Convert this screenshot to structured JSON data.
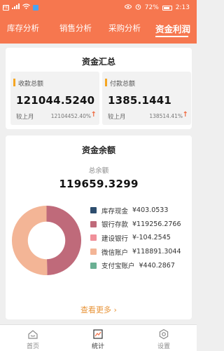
{
  "statusbar": {
    "left_badge": "HD",
    "battery": "72%",
    "time": "2:13"
  },
  "tabs": [
    {
      "label": "库存分析"
    },
    {
      "label": "销售分析"
    },
    {
      "label": "采购分析"
    },
    {
      "label": "资金利润"
    }
  ],
  "summary": {
    "title": "资金汇总",
    "receipts": {
      "label": "收款总额",
      "value": "121044.5240",
      "compare_label": "较上月",
      "percent": "12104452.40%"
    },
    "payments": {
      "label": "付款总额",
      "value": "1385.1441",
      "compare_label": "较上月",
      "percent": "138514.41%"
    }
  },
  "balance": {
    "title": "资金余额",
    "total_label": "总余额",
    "total_value": "119659.3299",
    "legend": [
      {
        "name": "库存现金",
        "amount": "¥403.0533",
        "color": "#2e4e6e"
      },
      {
        "name": "银行存款",
        "amount": "¥119256.2766",
        "color": "#bf6a7a"
      },
      {
        "name": "建设银行",
        "amount": "¥-104.2545",
        "color": "#f0909a"
      },
      {
        "name": "微信账户",
        "amount": "¥118891.3044",
        "color": "#f3b596"
      },
      {
        "name": "支付宝账户",
        "amount": "¥440.2867",
        "color": "#6ab093"
      }
    ],
    "donut_shares": [
      0.497,
      0.503
    ],
    "more_label": "查看更多 ›"
  },
  "bottomnav": [
    {
      "label": "首页"
    },
    {
      "label": "统计"
    },
    {
      "label": "设置"
    }
  ],
  "colors": {
    "header": "#f6774f",
    "accent": "#f5a623",
    "up_arrow": "#f06a3f",
    "more_link": "#e8953a"
  }
}
